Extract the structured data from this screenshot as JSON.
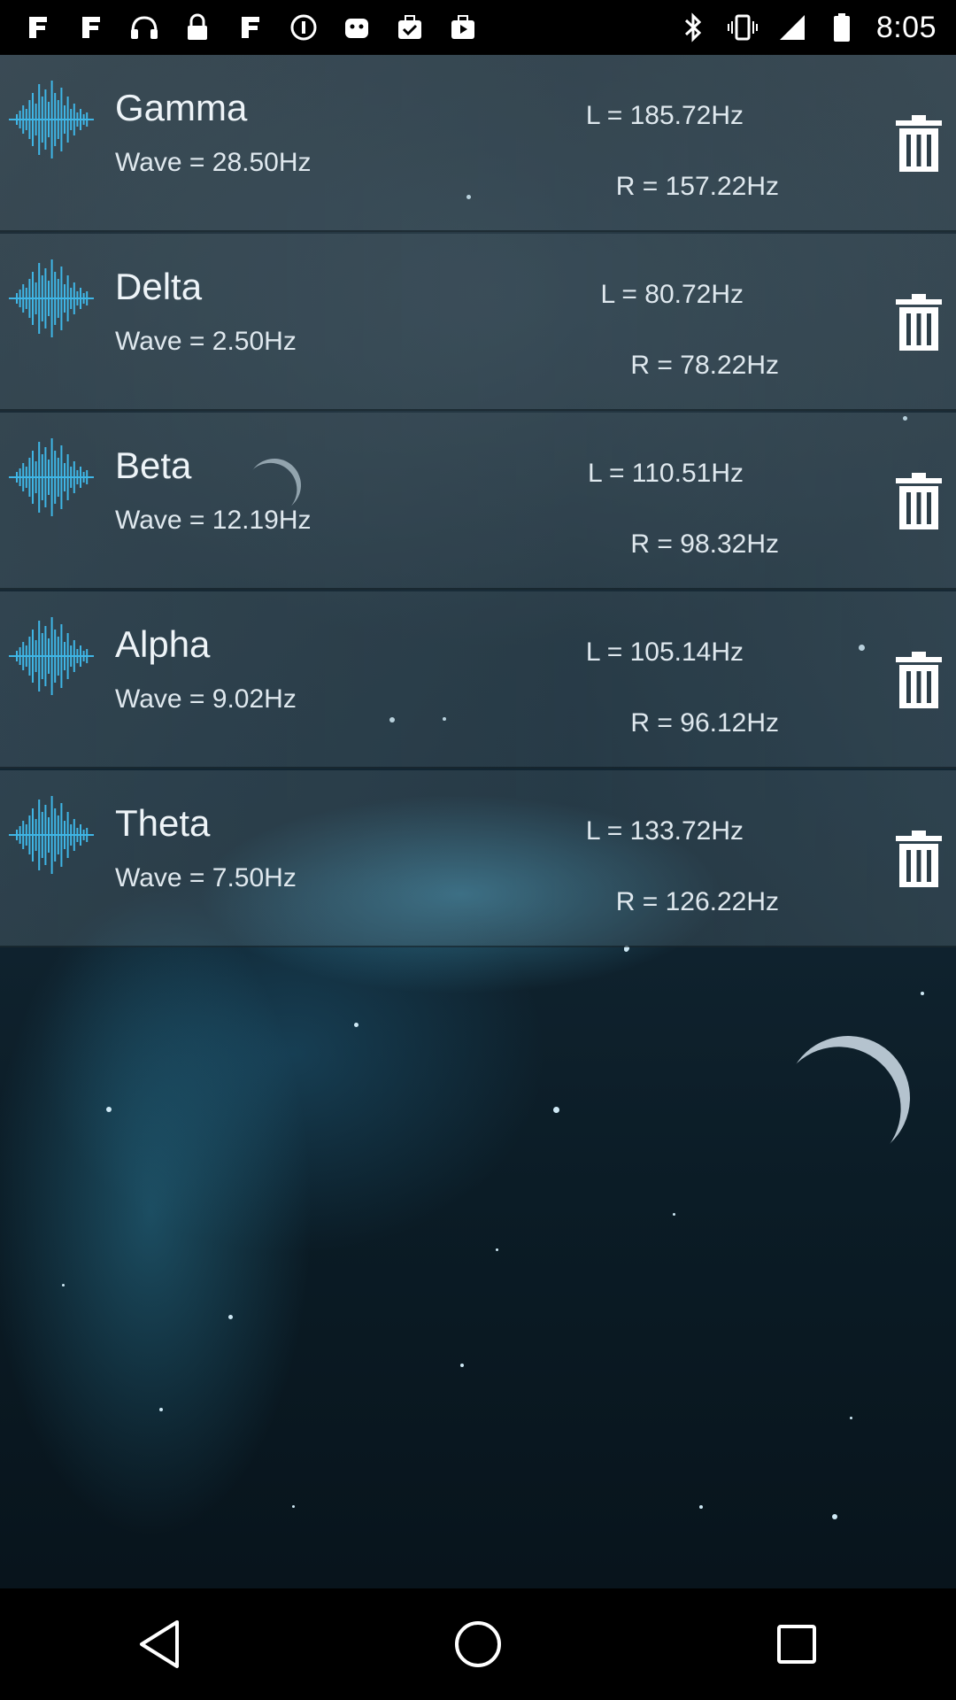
{
  "status_bar": {
    "left_icons": [
      "app-icon-1",
      "app-icon-2",
      "headphones-icon",
      "lock-icon",
      "app-icon-3",
      "info-icon",
      "game-controller-icon",
      "checkbox-bag-icon",
      "play-bag-icon"
    ],
    "right_icons": [
      "bluetooth-icon",
      "vibrate-icon",
      "signal-icon",
      "battery-icon"
    ],
    "time": "8:05"
  },
  "waves": [
    {
      "name": "Gamma",
      "wave": "Wave = 28.50Hz",
      "left": "L = 185.72Hz",
      "right": "R = 157.22Hz"
    },
    {
      "name": "Delta",
      "wave": "Wave = 2.50Hz",
      "left": "L = 80.72Hz",
      "right": "R = 78.22Hz"
    },
    {
      "name": "Beta",
      "wave": "Wave = 12.19Hz",
      "left": "L = 110.51Hz",
      "right": "R = 98.32Hz"
    },
    {
      "name": "Alpha",
      "wave": "Wave = 9.02Hz",
      "left": "L = 105.14Hz",
      "right": "R = 96.12Hz"
    },
    {
      "name": "Theta",
      "wave": "Wave = 7.50Hz",
      "left": "L = 133.72Hz",
      "right": "R = 126.22Hz"
    }
  ],
  "colors": {
    "accent_wave": "#3fb6e6",
    "status_bar_bg": "#000000",
    "nav_bar_bg": "#000000"
  },
  "nav_bar": [
    "back-icon",
    "home-icon",
    "recents-icon"
  ]
}
